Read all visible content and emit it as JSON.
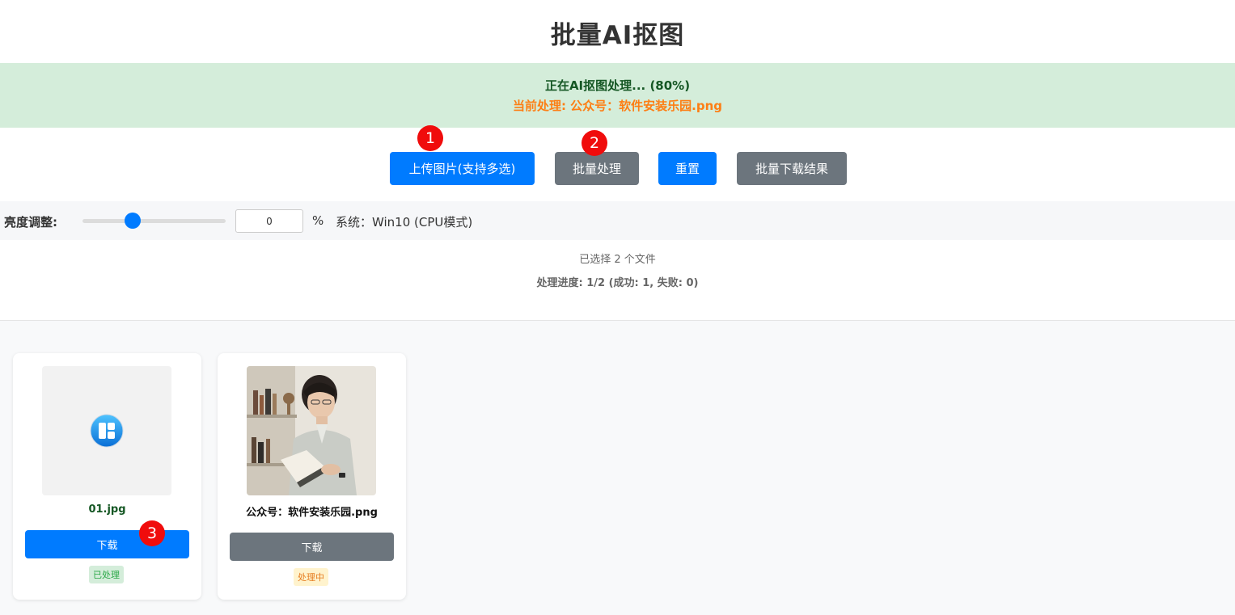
{
  "page": {
    "title": "批量AI抠图"
  },
  "status": {
    "main": "正在AI抠图处理... (80%)",
    "current": "当前处理: 公众号：软件安装乐园.png",
    "colors": {
      "background": "#d4edda",
      "main": "#155724",
      "current": "#fd7e14"
    }
  },
  "toolbar": {
    "upload_label": "上传图片(支持多选)",
    "process_label": "批量处理",
    "reset_label": "重置",
    "download_all_label": "批量下载结果"
  },
  "markers": {
    "m1": "1",
    "m2": "2",
    "m3": "3"
  },
  "controls": {
    "brightness_label": "亮度调整:",
    "brightness_value": "0",
    "brightness_level_percent": 35,
    "unit": "%",
    "system_label": "系统：Win10 (CPU模式)"
  },
  "summary": {
    "file_count": "已选择 2 个文件",
    "progress": "处理进度: 1/2 (成功: 1, 失败: 0)"
  },
  "files": [
    {
      "name": "01.jpg",
      "download_label": "下载",
      "status": "已处理",
      "thumb_icon": "app-grid-icon"
    },
    {
      "name": "公众号：软件安装乐园.png",
      "download_label": "下载",
      "status": "处理中",
      "thumb_icon": "photo-icon"
    }
  ],
  "colors": {
    "primary": "#007bff",
    "secondary": "#6c757d",
    "marker": "#f00c0c"
  }
}
